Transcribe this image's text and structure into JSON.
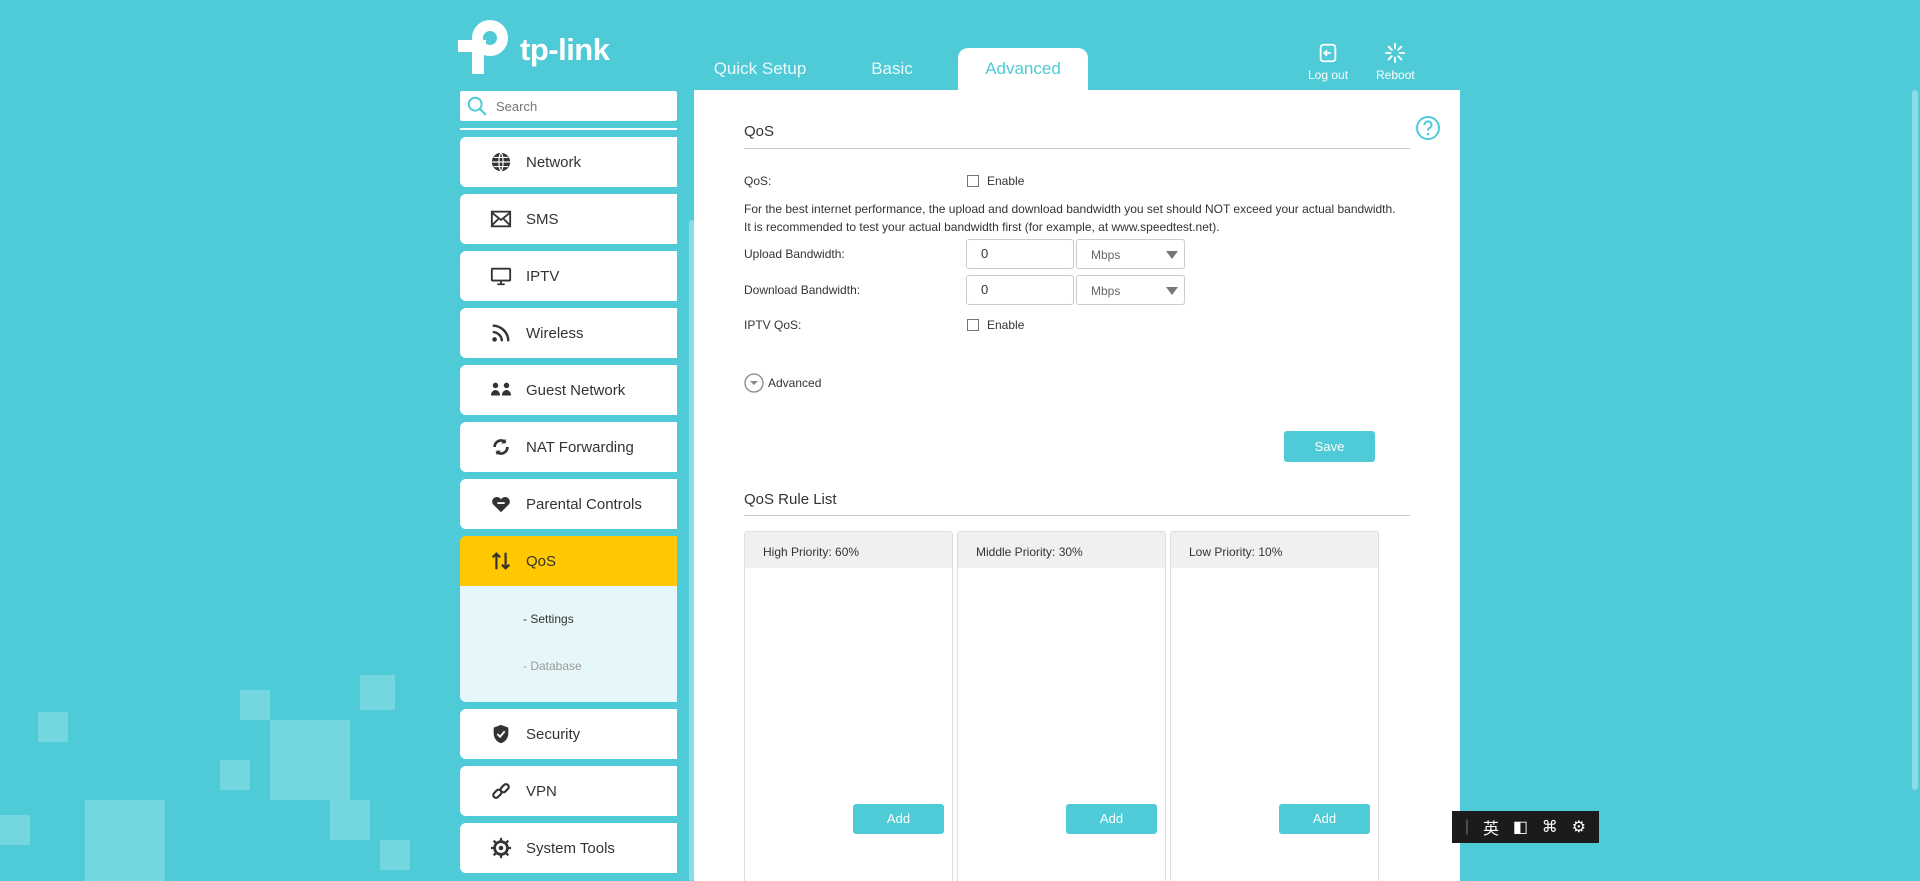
{
  "brand": {
    "name": "tp-link"
  },
  "tabs": [
    {
      "label": "Quick Setup"
    },
    {
      "label": "Basic"
    },
    {
      "label": "Advanced"
    }
  ],
  "top_actions": {
    "logout_label": "Log out",
    "reboot_label": "Reboot"
  },
  "search": {
    "placeholder": "Search"
  },
  "sidebar": {
    "items": [
      {
        "label": "Network",
        "icon": "globe-icon"
      },
      {
        "label": "SMS",
        "icon": "envelope-icon"
      },
      {
        "label": "IPTV",
        "icon": "monitor-icon"
      },
      {
        "label": "Wireless",
        "icon": "wifi-icon"
      },
      {
        "label": "Guest Network",
        "icon": "guests-icon"
      },
      {
        "label": "NAT Forwarding",
        "icon": "nat-icon"
      },
      {
        "label": "Parental Controls",
        "icon": "heart-icon"
      },
      {
        "label": "QoS",
        "icon": "updown-arrows-icon",
        "active": true
      },
      {
        "label": "Security",
        "icon": "shield-icon"
      },
      {
        "label": "VPN",
        "icon": "link-icon"
      },
      {
        "label": "System Tools",
        "icon": "gear-icon"
      }
    ],
    "qos_sub": [
      {
        "label": "- Settings",
        "active": true
      },
      {
        "label": "- Database"
      }
    ]
  },
  "qos": {
    "title": "QoS",
    "qos_label": "QoS:",
    "enable_label": "Enable",
    "note_line1": "For the best internet performance, the upload and download bandwidth you set should NOT exceed your actual bandwidth.",
    "note_line2": "It is recommended to test your actual bandwidth first (for example, at www.speedtest.net).",
    "upload_label": "Upload Bandwidth:",
    "upload_value": "0",
    "upload_unit": "Mbps",
    "download_label": "Download Bandwidth:",
    "download_value": "0",
    "download_unit": "Mbps",
    "iptv_label": "IPTV QoS:",
    "iptv_enable_label": "Enable",
    "advanced_label": "Advanced",
    "save_label": "Save"
  },
  "rule_list": {
    "title": "QoS Rule List",
    "columns": [
      {
        "header": "High Priority: 60%",
        "add_label": "Add"
      },
      {
        "header": "Middle Priority: 30%",
        "add_label": "Add"
      },
      {
        "header": "Low Priority: 10%",
        "add_label": "Add"
      }
    ]
  },
  "ime_toolbar": {
    "lang": "英"
  },
  "colors": {
    "accent": "#4ecbd7",
    "active_nav": "#ffc800"
  }
}
